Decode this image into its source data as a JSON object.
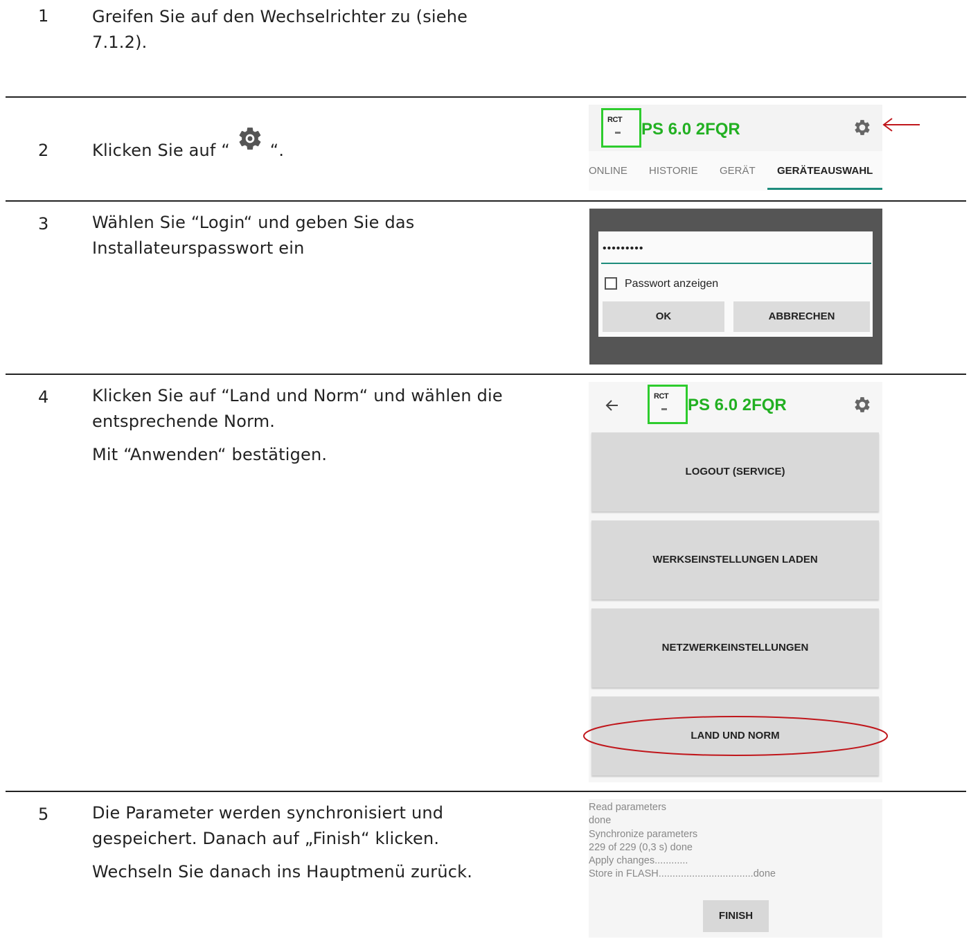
{
  "steps": [
    {
      "num": "1",
      "lines": [
        "Greifen Sie auf den Wechselrichter zu (siehe",
        "7.1.2)."
      ]
    },
    {
      "num": "2",
      "before": "Klicken Sie auf “",
      "after": "“."
    },
    {
      "num": "3",
      "lines": [
        "Wählen Sie  “Login“ und geben Sie das",
        "Installateurspasswort ein"
      ]
    },
    {
      "num": "4",
      "lines": [
        "Klicken Sie auf “Land und Norm“ und wählen die",
        "entsprechende Norm."
      ],
      "extra": "Mit “Anwenden“ bestätigen."
    },
    {
      "num": "5",
      "lines": [
        "Die Parameter werden synchronisiert und",
        "gespeichert. Danach auf „Finish“ klicken."
      ],
      "extra": "Wechseln Sie danach ins Hauptmenü zurück."
    }
  ],
  "app": {
    "logo_text": "RCT",
    "device_name": "PS 6.0 2FQR",
    "tabs": [
      "ONLINE",
      "HISTORIE",
      "GERÄT",
      "GERÄTEAUSWAHL"
    ]
  },
  "login_dialog": {
    "password_mask": "•••••••••",
    "show_password_label": "Passwort anzeigen",
    "ok_label": "OK",
    "cancel_label": "ABBRECHEN"
  },
  "menu": {
    "items": [
      "LOGOUT (SERVICE)",
      "WERKSEINSTELLUNGEN LADEN",
      "NETZWERKEINSTELLUNGEN",
      "LAND UND NORM"
    ]
  },
  "sync_log": {
    "lines": [
      "Read parameters",
      "done",
      "Synchronize parameters",
      "229 of 229 (0,3 s) done",
      "Apply changes............",
      "Store in FLASH..................................done"
    ],
    "finish_label": "FINISH"
  },
  "colors": {
    "accent_green": "#22b022",
    "tab_underline": "#1e8c7c",
    "highlight_red": "#c0161b"
  },
  "icons": [
    "gear-icon",
    "back-arrow-icon",
    "red-arrow-icon"
  ]
}
